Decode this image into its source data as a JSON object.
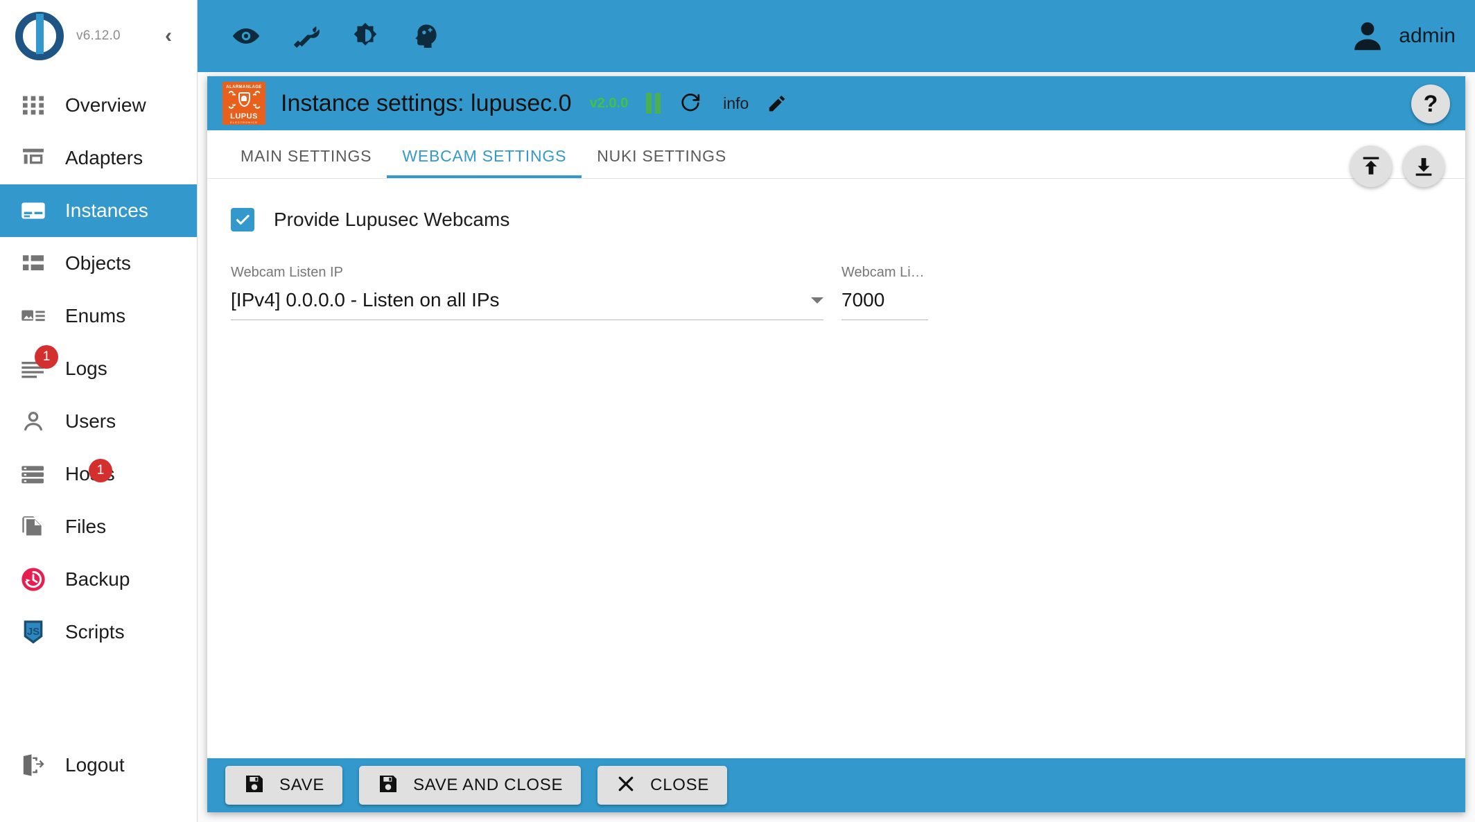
{
  "sidebar": {
    "version": "v6.12.0",
    "collapse_icon": "chevron-left-icon",
    "items": [
      {
        "label": "Overview",
        "icon": "grid-icon",
        "badge": null,
        "selected": false
      },
      {
        "label": "Adapters",
        "icon": "store-icon",
        "badge": null,
        "selected": false
      },
      {
        "label": "Instances",
        "icon": "instances-icon",
        "badge": null,
        "selected": true
      },
      {
        "label": "Objects",
        "icon": "list-icon",
        "badge": null,
        "selected": false
      },
      {
        "label": "Enums",
        "icon": "enums-icon",
        "badge": null,
        "selected": false
      },
      {
        "label": "Logs",
        "icon": "logs-icon",
        "badge": "1",
        "selected": false
      },
      {
        "label": "Users",
        "icon": "user-icon",
        "badge": null,
        "selected": false
      },
      {
        "label": "Hosts",
        "icon": "server-icon",
        "badge": "1",
        "selected": false
      },
      {
        "label": "Files",
        "icon": "files-icon",
        "badge": null,
        "selected": false
      },
      {
        "label": "Backup",
        "icon": "backup-restore-icon",
        "badge": null,
        "selected": false
      },
      {
        "label": "Scripts",
        "icon": "javascript-icon",
        "badge": null,
        "selected": false
      }
    ],
    "logout": {
      "label": "Logout",
      "icon": "logout-icon"
    }
  },
  "topbar": {
    "icons": [
      "eye-icon",
      "wrench-icon",
      "brightness-icon",
      "psychology-icon"
    ],
    "user": {
      "name": "admin",
      "icon": "account-circle-icon"
    }
  },
  "dialog": {
    "logo": {
      "top_text": "ALARMANLAGE",
      "brand": "LUPUS",
      "sub": "ELECTRONICS"
    },
    "title": "Instance settings: lupusec.0",
    "version": "v2.0.0",
    "pause_icon": "pause-icon",
    "refresh_icon": "refresh-icon",
    "info_label": "info",
    "edit_icon": "pencil-icon",
    "help_label": "?",
    "tabs": [
      {
        "label": "MAIN SETTINGS",
        "active": false
      },
      {
        "label": "WEBCAM SETTINGS",
        "active": true
      },
      {
        "label": "NUKI SETTINGS",
        "active": false
      }
    ],
    "fabs": [
      {
        "icon": "upload-icon"
      },
      {
        "icon": "download-icon"
      }
    ],
    "form": {
      "checkbox": {
        "label": "Provide Lupusec Webcams",
        "checked": true
      },
      "listen_ip": {
        "label": "Webcam Listen IP",
        "value": "[IPv4] 0.0.0.0 - Listen on all IPs"
      },
      "listen_port": {
        "label": "Webcam Li…",
        "value": "7000"
      }
    },
    "footer": {
      "save": {
        "label": "SAVE",
        "icon": "save-icon"
      },
      "save_close": {
        "label": "SAVE AND CLOSE",
        "icon": "save-icon"
      },
      "close": {
        "label": "CLOSE",
        "icon": "close-icon"
      }
    }
  },
  "colors": {
    "accent": "#3399cc",
    "badge": "#d32f2f",
    "version_green": "#3ec43e",
    "lupus_orange": "#e8601c"
  }
}
